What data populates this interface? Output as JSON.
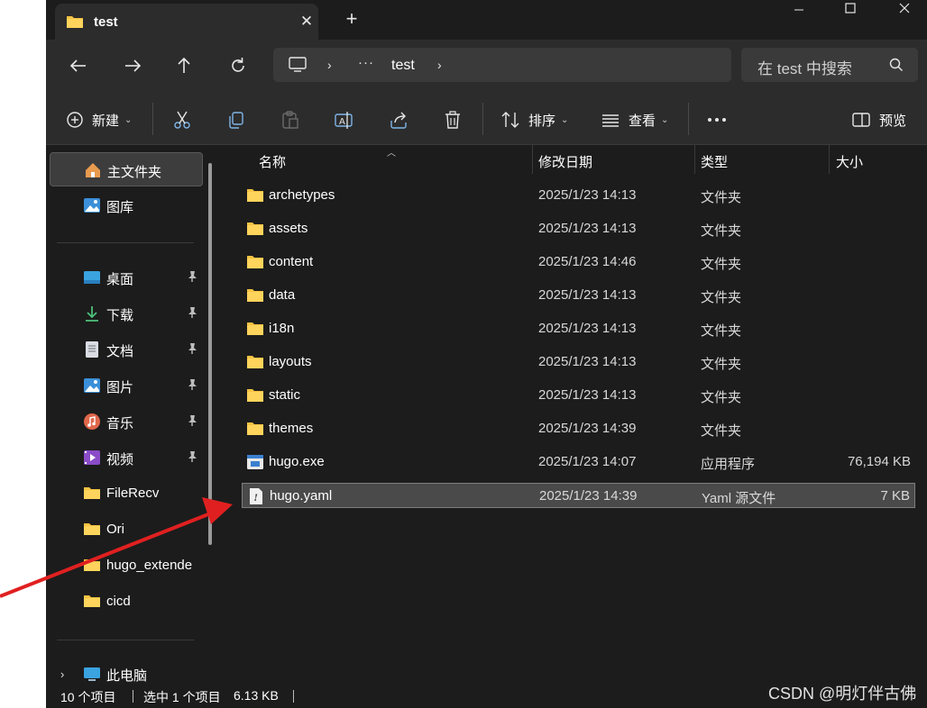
{
  "tab": {
    "title": "test"
  },
  "address": {
    "more": "···",
    "crumb": "test"
  },
  "search": {
    "placeholder": "在 test 中搜索"
  },
  "toolbar": {
    "new": "新建",
    "sort": "排序",
    "view": "查看",
    "preview": "预览"
  },
  "sidebar": {
    "items": [
      {
        "label": "主文件夹",
        "icon": "home-icon"
      },
      {
        "label": "图库",
        "icon": "gallery-icon"
      },
      {
        "label": "桌面",
        "icon": "desktop-icon"
      },
      {
        "label": "下载",
        "icon": "download-icon"
      },
      {
        "label": "文档",
        "icon": "document-icon"
      },
      {
        "label": "图片",
        "icon": "pictures-icon"
      },
      {
        "label": "音乐",
        "icon": "music-icon"
      },
      {
        "label": "视频",
        "icon": "video-icon"
      },
      {
        "label": "FileRecv",
        "icon": "folder-icon"
      },
      {
        "label": "Ori",
        "icon": "folder-icon"
      },
      {
        "label": "hugo_extende",
        "icon": "folder-icon"
      },
      {
        "label": "cicd",
        "icon": "folder-icon"
      },
      {
        "label": "此电脑",
        "icon": "computer-icon"
      }
    ]
  },
  "columns": {
    "name": "名称",
    "date": "修改日期",
    "type": "类型",
    "size": "大小"
  },
  "files": [
    {
      "name": "archetypes",
      "date": "2025/1/23 14:13",
      "type": "文件夹",
      "size": ""
    },
    {
      "name": "assets",
      "date": "2025/1/23 14:13",
      "type": "文件夹",
      "size": ""
    },
    {
      "name": "content",
      "date": "2025/1/23 14:46",
      "type": "文件夹",
      "size": ""
    },
    {
      "name": "data",
      "date": "2025/1/23 14:13",
      "type": "文件夹",
      "size": ""
    },
    {
      "name": "i18n",
      "date": "2025/1/23 14:13",
      "type": "文件夹",
      "size": ""
    },
    {
      "name": "layouts",
      "date": "2025/1/23 14:13",
      "type": "文件夹",
      "size": ""
    },
    {
      "name": "static",
      "date": "2025/1/23 14:13",
      "type": "文件夹",
      "size": ""
    },
    {
      "name": "themes",
      "date": "2025/1/23 14:39",
      "type": "文件夹",
      "size": ""
    },
    {
      "name": "hugo.exe",
      "date": "2025/1/23 14:07",
      "type": "应用程序",
      "size": "76,194 KB"
    },
    {
      "name": "hugo.yaml",
      "date": "2025/1/23 14:39",
      "type": "Yaml 源文件",
      "size": "7 KB"
    }
  ],
  "status": {
    "count": "10 个项目",
    "selected": "选中 1 个项目",
    "size": "6.13 KB"
  },
  "watermark": "CSDN @明灯伴古佛",
  "colors": {
    "window_bg": "#1c1c1c",
    "toolbar_bg": "#2c2c2c",
    "folder": "#f5c242",
    "annotation_arrow": "#e02020"
  }
}
